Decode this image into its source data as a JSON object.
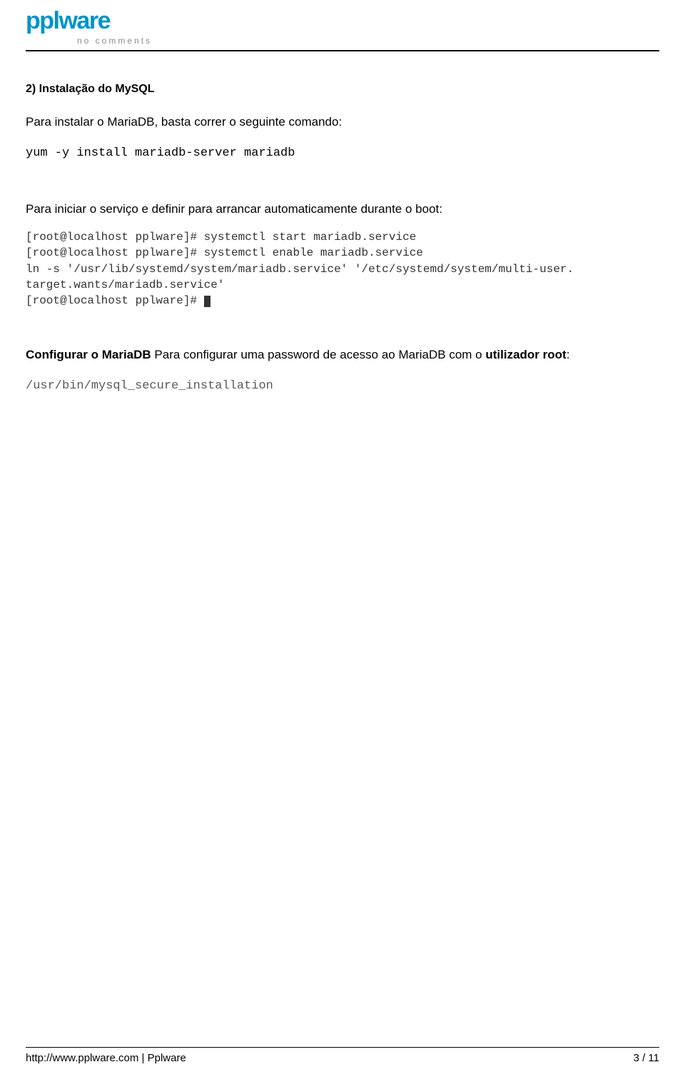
{
  "header": {
    "logo_text": "pplware",
    "tagline": "no comments"
  },
  "body": {
    "step_heading": "2) Instalação do MySQL",
    "intro_para": "Para instalar o MariaDB, basta correr o seguinte comando:",
    "cmd1": "yum -y install mariadb-server mariadb",
    "boot_para": "Para iniciar o serviço e definir para arrancar automaticamente durante o boot:",
    "terminal_lines": [
      "[root@localhost pplware]# systemctl start mariadb.service",
      "[root@localhost pplware]# systemctl enable mariadb.service",
      "ln -s '/usr/lib/systemd/system/mariadb.service' '/etc/systemd/system/multi-user.",
      "target.wants/mariadb.service'",
      "[root@localhost pplware]# "
    ],
    "config_strong1": "Configurar o MariaDB",
    "config_mid": " Para configurar uma password de acesso ao MariaDB com o ",
    "config_strong2": "utilizador root",
    "config_tail": ":",
    "cmd2": "/usr/bin/mysql_secure_installation"
  },
  "footer": {
    "left": "http://www.pplware.com | Pplware",
    "right": "3 / 11"
  }
}
